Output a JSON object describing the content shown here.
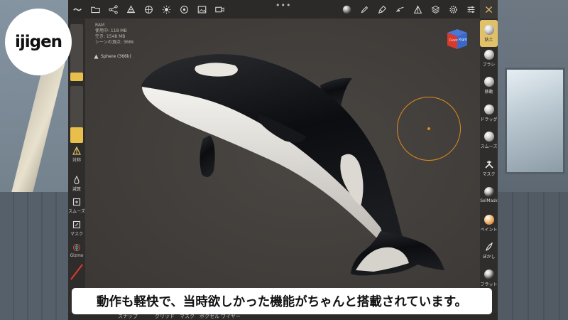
{
  "logo": {
    "text": "ijigen"
  },
  "topbar": {
    "left_icons": [
      "menu-wave-icon",
      "folder-icon",
      "share-icon",
      "scene-tree-icon",
      "globe-icon",
      "sun-icon",
      "material-icon",
      "image-icon",
      "video-icon"
    ],
    "more": "•••",
    "right_icons": [
      "sphere-material-icon",
      "pen-icon",
      "paint-brush-icon",
      "shapes-icon",
      "topology-icon",
      "layers-icon",
      "gear-icon",
      "sliders-icon",
      "tools-icon"
    ]
  },
  "stats": {
    "ram_label": "RAM",
    "used": "使用中: 118 MB",
    "free": "空き: 1548 MB",
    "vertices": "シーンの頂点: 366k"
  },
  "scene": {
    "object": "Sphere (366k)"
  },
  "left_tools": {
    "radius_fill": 0.15,
    "intensity_fill": 0.28,
    "symmetry": "対称",
    "subtract": "減算",
    "smooth": "スムーズ",
    "mask": "マスク",
    "gizmo": "Gizmo"
  },
  "viewcube": {
    "front": "Front",
    "right": "Right"
  },
  "right_tools": [
    {
      "id": "clay",
      "label": "粘土",
      "active": true
    },
    {
      "id": "brush",
      "label": "ブラシ",
      "active": false
    },
    {
      "id": "move",
      "label": "移動",
      "active": false
    },
    {
      "id": "drag",
      "label": "ドラッグ",
      "active": false
    },
    {
      "id": "smooth",
      "label": "スムーズ",
      "active": false
    },
    {
      "id": "mask",
      "label": "マスク",
      "active": false
    },
    {
      "id": "selmask",
      "label": "SelMask",
      "active": false
    },
    {
      "id": "paint",
      "label": "ペイント",
      "active": false
    },
    {
      "id": "blur",
      "label": "ぼかし",
      "active": false
    },
    {
      "id": "flatten",
      "label": "フラット",
      "active": false
    }
  ],
  "bottombar": {
    "snap": "スナップ",
    "grid": "グリッド",
    "mask": "マスク",
    "voxel": "ボクセル",
    "wire": "ワイヤー"
  },
  "subtitle": {
    "text": "動作も軽快で、当時欲しかった機能がちゃんと搭載されています。"
  },
  "colors": {
    "accent": "#e1c06a",
    "brush_ring": "#e08a1e",
    "panel": "#2f2d2b"
  }
}
